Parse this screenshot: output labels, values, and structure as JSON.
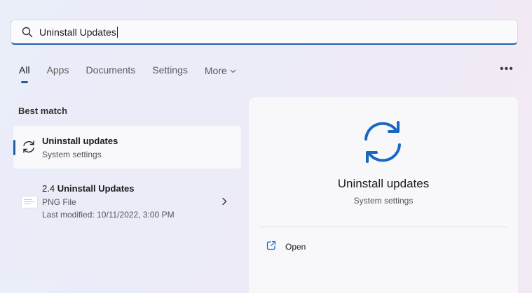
{
  "search": {
    "query": "Uninstall Updates",
    "icon": "search-icon"
  },
  "tabs": [
    {
      "label": "All",
      "active": true
    },
    {
      "label": "Apps"
    },
    {
      "label": "Documents"
    },
    {
      "label": "Settings"
    },
    {
      "label": "More"
    }
  ],
  "more_options": "•••",
  "best_match": {
    "heading": "Best match",
    "title": "Uninstall updates",
    "subtitle": "System settings",
    "icon": "sync-icon"
  },
  "file_result": {
    "title_prefix": "2.4 ",
    "title_main": "Uninstall Updates",
    "type": "PNG File",
    "modified": "Last modified: 10/11/2022, 3:00 PM",
    "icon": "png-file-thumbnail"
  },
  "preview": {
    "title": "Uninstall updates",
    "subtitle": "System settings",
    "action_label": "Open",
    "action_icon": "open-external-icon"
  },
  "colors": {
    "accent": "#1f5fa8",
    "sync_icon_blue": "#1a66c4"
  }
}
